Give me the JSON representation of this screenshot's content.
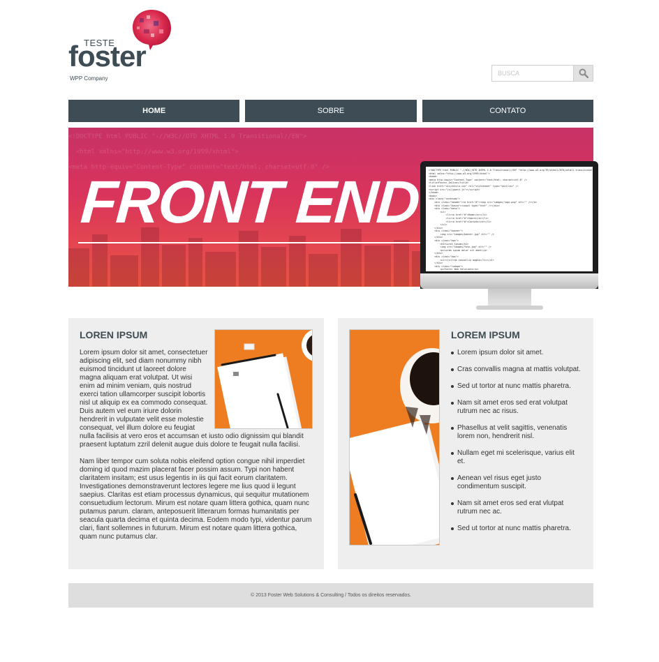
{
  "brand": {
    "tag": "TESTE",
    "name": "foster",
    "sub": "WPP Company"
  },
  "search": {
    "placeholder": "BUSCA"
  },
  "nav": {
    "items": [
      {
        "label": "HOME"
      },
      {
        "label": "SOBRE"
      },
      {
        "label": "CONTATO"
      }
    ]
  },
  "banner": {
    "title": "FRONT END"
  },
  "panel_left": {
    "title": "LOREN IPSUM",
    "p1": "Lorem ipsum dolor sit amet, consectetuer adipiscing elit, sed diam nonummy nibh euismod tincidunt ut laoreet dolore magna aliquam erat volutpat. Ut wisi enim ad minim veniam, quis nostrud exerci tation ullamcorper suscipit lobortis nisl ut aliquip ex ea commodo consequat. Duis autem vel eum iriure dolorin hendrerit in vulputate velit esse molestie consequat, vel illum dolore eu feugiat nulla facilisis at vero eros et accumsan et iusto odio dignissim qui blandit praesent luptatum zzril delenit augue duis dolore te feugait nulla facilisi.",
    "p2": "Nam liber tempor cum soluta nobis eleifend option congue nihil imperdiet doming id quod mazim placerat facer possim assum. Typi non habent claritatem insitam; est usus legentis in iis qui facit eorum claritatem. Investigationes demonstraverunt lectores legere me lius quod ii legunt saepius. Claritas est etiam processus dynamicus, qui sequitur mutationem consuetudium lectorum. Mirum est notare quam littera gothica, quam nunc putamus parum. claram, anteposuerit litterarum formas humanitatis per seacula quarta decima et quinta decima. Eodem modo typi, videntur parum clari, fiant sollemnes in futurum. Mirum est notare quam littera gothica, quam nunc putamus clar."
  },
  "panel_right": {
    "title": "LOREM IPSUM",
    "items": [
      "Lorem ipsum dolor sit amet.",
      "Cras convallis magna at mattis volutpat.",
      "Sed ut tortor at nunc mattis pharetra.",
      "Nam sit amet eros sed erat volutpat rutrum nec ac risus.",
      "Phasellus at velit sagittis, venenatis lorem non, hendrerit nisl.",
      "Nullam eget mi scelerisque, varius elit et.",
      "Aenean vel risus eget justo condimentum suscipit.",
      "Nam sit amet eros sed erat vlutpat rutrum nec ac.",
      "Sed ut tortor at nunc mattis pharetra."
    ]
  },
  "footer": {
    "text": "© 2013 Foster Web Solutions & Consulting / Todos os direitos reservados."
  },
  "colors": {
    "nav": "#3d4c55",
    "banner_top": "#c73266",
    "banner_bottom": "#e8533f",
    "panel_bg": "#eeeeee",
    "footer_bg": "#dedede",
    "photo_orange": "#ee7d22"
  },
  "icons": {
    "search": "magnifier-icon"
  }
}
